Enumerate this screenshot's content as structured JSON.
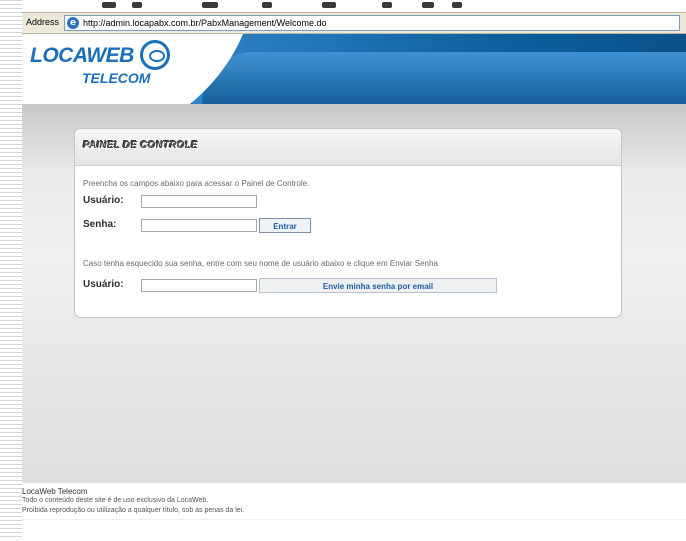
{
  "browser": {
    "address_label": "Address",
    "url": "http://admin.locapabx.com.br/PabxManagement/Welcome.do"
  },
  "header": {
    "logo_top": "LOCAWEB",
    "logo_bottom": "TELECOM"
  },
  "panel": {
    "title": "PAINEL DE CONTROLE",
    "login_instruction": "Preencha os campos abaixo para acessar o Painel de Controle.",
    "user_label": "Usuário:",
    "password_label": "Senha:",
    "enter_button": "Entrar",
    "forgot_instruction": "Caso tenha esquecido sua senha, entre com seu nome de usuário abaixo e clique em Enviar Senha",
    "forgot_user_label": "Usuário:",
    "send_button": "Envie minha senha por email"
  },
  "footer": {
    "company": "LocaWeb Telecom",
    "line1": "Todo o conteúdo deste site é de uso exclusivo da LocaWeb.",
    "line2": "Proibida reprodução ou utilização a qualquer título, sob as penas da lei."
  },
  "colors": {
    "header_blue": "#0a5d9c",
    "link_blue": "#1b5ea8"
  }
}
